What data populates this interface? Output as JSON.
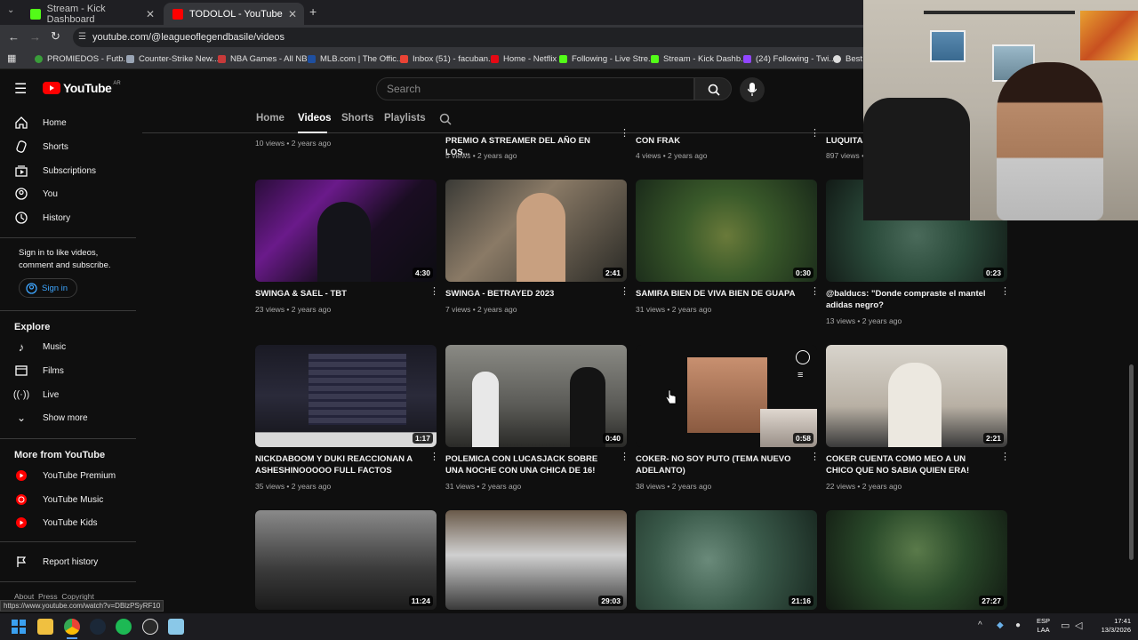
{
  "browser": {
    "tabs": [
      {
        "title": "Stream - Kick Dashboard",
        "color": "#53fc18"
      },
      {
        "title": "TODOLOL - YouTube",
        "color": "#ff0000"
      }
    ],
    "url": "youtube.com/@leagueoflegendbasile/videos",
    "bookmarks": [
      "PROMIEDOS - Futb...",
      "Counter-Strike New...",
      "NBA Games - All NB...",
      "MLB.com | The Offic...",
      "Inbox (51) - facuban...",
      "Home - Netflix",
      "Following - Live Stre...",
      "Stream - Kick Dashb...",
      "(24) Following - Twi...",
      "Best F"
    ],
    "status_url": "https://www.youtube.com/watch?v=DBlzPSyRF10"
  },
  "youtube": {
    "logo": "YouTube",
    "region": "AR",
    "search_placeholder": "Search"
  },
  "channel_tabs": [
    "Home",
    "Videos",
    "Shorts",
    "Playlists"
  ],
  "sidebar": {
    "main": [
      "Home",
      "Shorts",
      "Subscriptions",
      "You",
      "History"
    ],
    "signin_text": "Sign in to like videos, comment and subscribe.",
    "signin_button": "Sign in",
    "explore_title": "Explore",
    "explore": [
      "Music",
      "Films",
      "Live",
      "Show more"
    ],
    "more_title": "More from YouTube",
    "more": [
      "YouTube Premium",
      "YouTube Music",
      "YouTube Kids"
    ],
    "report": "Report history",
    "footer": [
      "About",
      "Press",
      "Copyright"
    ]
  },
  "top_row": [
    {
      "title": "",
      "meta": "10 views • 2 years ago"
    },
    {
      "title": "PREMIO A STREAMER DEL AÑO EN LOS...",
      "meta": "5 views • 2 years ago"
    },
    {
      "title": "CON FRAK",
      "meta": "4 views • 2 years ago"
    },
    {
      "title": "LUQUITAS",
      "meta": "897 views •"
    }
  ],
  "rows": [
    [
      {
        "title": "SWINGA & SAEL - TBT",
        "meta": "23 views • 2 years ago",
        "duration": "4:30"
      },
      {
        "title": "SWINGA - BETRAYED 2023",
        "meta": "7 views • 2 years ago",
        "duration": "2:41"
      },
      {
        "title": "SAMIRA BIEN DE VIVA BIEN DE GUAPA",
        "meta": "31 views • 2 years ago",
        "duration": "0:30"
      },
      {
        "title": "@balducs: \"Donde compraste el mantel adidas negro?",
        "meta": "13 views • 2 years ago",
        "duration": "0:23"
      }
    ],
    [
      {
        "title": "NICKDABOOM Y DUKI REACCIONAN A ASHESHINOOOOO FULL FACTOS",
        "meta": "35 views • 2 years ago",
        "duration": "1:17"
      },
      {
        "title": "POLEMICA CON LUCASJACK SOBRE UNA NOCHE CON UNA CHICA DE 16! OPINIONE...",
        "meta": "31 views • 2 years ago",
        "duration": "0:40"
      },
      {
        "title": "COKER- NO SOY PUTO (TEMA NUEVO ADELANTO)",
        "meta": "38 views • 2 years ago",
        "duration": "0:58"
      },
      {
        "title": "COKER CUENTA COMO MEO A UN CHICO QUE NO SABIA QUIEN ERA! DESPUES DEL...",
        "meta": "22 views • 2 years ago",
        "duration": "2:21"
      }
    ],
    [
      {
        "title": "",
        "meta": "",
        "duration": "11:24"
      },
      {
        "title": "",
        "meta": "",
        "duration": "29:03"
      },
      {
        "title": "",
        "meta": "",
        "duration": "21:16"
      },
      {
        "title": "",
        "meta": "",
        "duration": "27:27"
      }
    ]
  ],
  "taskbar": {
    "lang": "ESP",
    "lang2": "LAA",
    "time": "17:41",
    "date": "13/3/2026"
  }
}
